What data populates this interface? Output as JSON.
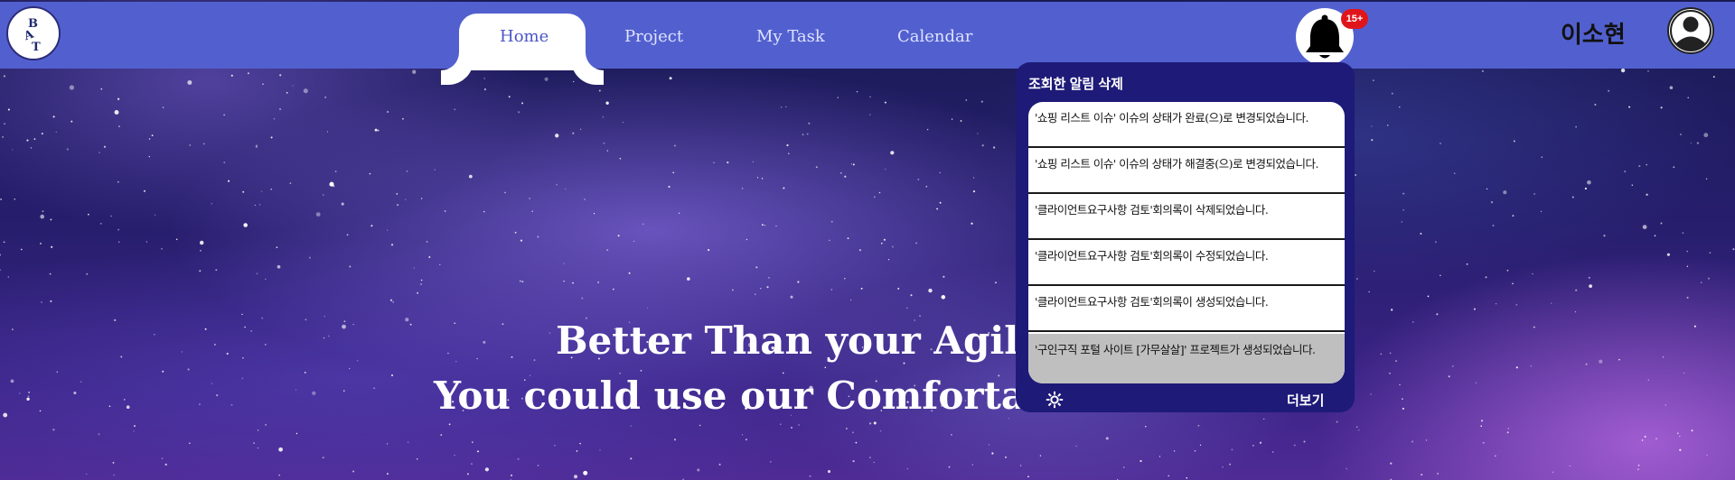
{
  "navbar": {
    "logo_letters": [
      "B",
      "A",
      "T"
    ],
    "tabs": [
      {
        "label": "Home",
        "active": true
      },
      {
        "label": "Project",
        "active": false
      },
      {
        "label": "My Task",
        "active": false
      },
      {
        "label": "Calendar",
        "active": false
      }
    ],
    "notification_badge": "15+",
    "username": "이소현",
    "icons": {
      "bell": "bell-icon",
      "avatar": "user-avatar-icon"
    }
  },
  "hero": {
    "line1": "Better Than your Agile Tool",
    "line2": "You could use our Comfortable function"
  },
  "notifications": {
    "title": "조회한 알림 삭제",
    "items": [
      "'쇼핑 리스트 이슈' 이슈의 상태가 완료(으)로 변경되었습니다.",
      "'쇼핑 리스트 이슈' 이슈의 상태가 해결중(으)로 변경되었습니다.",
      "'클라이언트요구사항 검토'회의록이 삭제되었습니다.",
      "'클라이언트요구사항 검토'회의록이 수정되었습니다.",
      "'클라이언트요구사항 검토'회의록이 생성되었습니다.",
      "'구인구직 포털 사이트 [가무살살]' 프로젝트가 생성되었습니다."
    ],
    "more_label": "더보기",
    "settings_icon": "gear-icon"
  },
  "colors": {
    "navbar": "#5260cf",
    "popup": "#1e1a78",
    "badge": "#e0151b",
    "active_tab_text": "#4a55c6"
  }
}
